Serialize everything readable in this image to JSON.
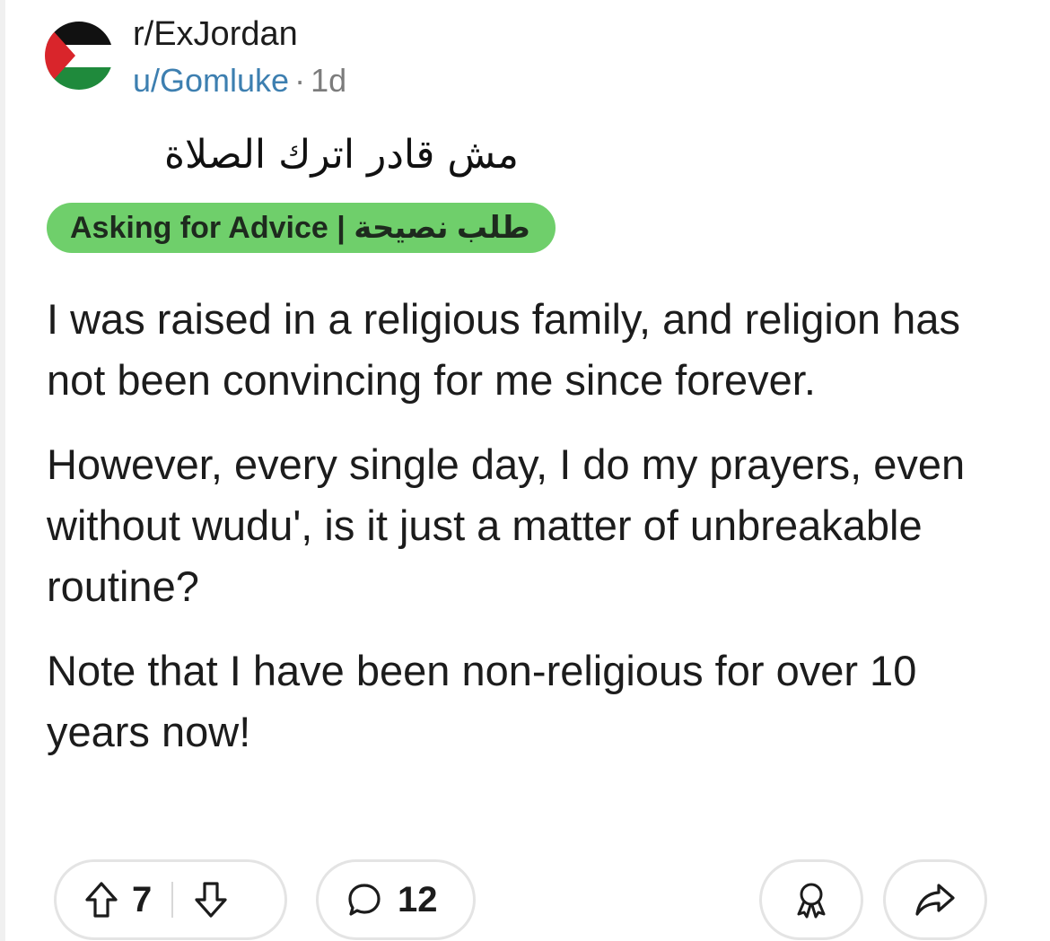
{
  "header": {
    "subreddit": "r/ExJordan",
    "username": "u/Gomluke",
    "separator": "·",
    "age": "1d",
    "avatar_icon": "palestine-flag-icon"
  },
  "post": {
    "title": "مش قادر اترك الصلاة",
    "flair": "Asking for Advice | طلب نصيحة",
    "body": [
      "I was raised in a religious family, and religion has not been convincing for me since forever.",
      "However, every single day, I do my prayers, even without wudu', is it just a matter of unbreakable routine?",
      "Note that I have been non-religious for over 10 years now!"
    ]
  },
  "actions": {
    "upvote_icon": "upvote-arrow-icon",
    "vote_count": "7",
    "downvote_icon": "downvote-arrow-icon",
    "comment_icon": "comment-bubble-icon",
    "comment_count": "12",
    "award_icon": "award-icon",
    "share_icon": "share-arrow-icon"
  },
  "colors": {
    "flair_bg": "#6fcf6b",
    "username": "#3d7fb0",
    "meta_gray": "#7c7c7c",
    "pill_border": "#e4e4e4"
  }
}
